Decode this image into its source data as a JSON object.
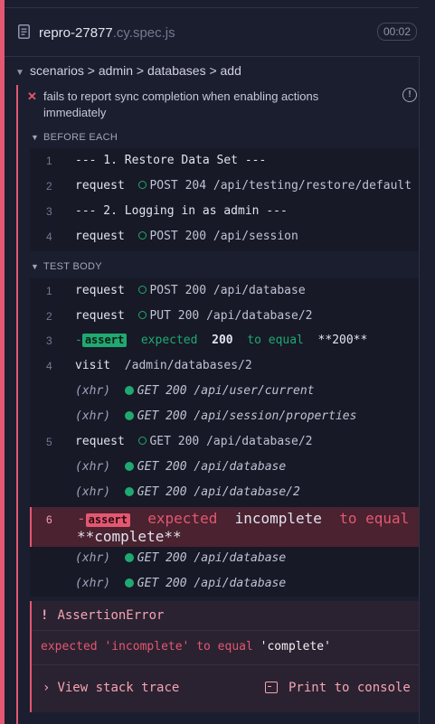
{
  "spec": {
    "name": "repro-27877",
    "ext": ".cy.spec.js",
    "duration": "00:02"
  },
  "suite": {
    "path": "scenarios > admin > databases > add"
  },
  "test": {
    "title": "fails to report sync completion when enabling actions immediately"
  },
  "before_each": {
    "label": "BEFORE EACH",
    "rows": [
      {
        "num": "1",
        "text": "--- 1. Restore Data Set ---"
      },
      {
        "num": "2",
        "cmd": "request",
        "method": "POST 204",
        "path": "/api/testing/restore/default"
      },
      {
        "num": "3",
        "text": "--- 2. Logging in as admin ---"
      },
      {
        "num": "4",
        "cmd": "request",
        "method": "POST 200",
        "path": "/api/session"
      }
    ]
  },
  "test_body": {
    "label": "TEST BODY",
    "rows": [
      {
        "num": "1",
        "cmd": "request",
        "method": "POST 200",
        "path": "/api/database"
      },
      {
        "num": "2",
        "cmd": "request",
        "method": "PUT 200",
        "path": "/api/database/2"
      },
      {
        "num": "3",
        "badge": "assert",
        "expected": "expected",
        "val1": "200",
        "to_equal": "to equal",
        "val2": "**200**"
      },
      {
        "num": "4",
        "cmd": "visit",
        "path": "/admin/databases/2"
      },
      {
        "xhr": "(xhr)",
        "method": "GET 200",
        "path": "/api/user/current"
      },
      {
        "xhr": "(xhr)",
        "method": "GET 200",
        "path": "/api/session/properties"
      },
      {
        "num": "5",
        "cmd": "request",
        "method": "GET 200",
        "path": "/api/database/2"
      },
      {
        "xhr": "(xhr)",
        "method": "GET 200",
        "path": "/api/database"
      },
      {
        "xhr": "(xhr)",
        "method": "GET 200",
        "path": "/api/database/2"
      },
      {
        "num": "6",
        "badge": "assert",
        "expected": "expected",
        "val1": "incomplete",
        "to_equal": "to equal",
        "val2": "**complete**"
      },
      {
        "xhr": "(xhr)",
        "method": "GET 200",
        "path": "/api/database"
      },
      {
        "xhr": "(xhr)",
        "method": "GET 200",
        "path": "/api/database"
      }
    ]
  },
  "error": {
    "bang": "!",
    "type": "AssertionError",
    "msg_prefix": "expected",
    "actual": "'incomplete'",
    "msg_mid": "to equal",
    "expected": "'complete'",
    "stack_label": "View stack trace",
    "console_label": "Print to console"
  },
  "colors": {
    "fail": "#e45770",
    "pass": "#1fa971",
    "background": "#1b1e2e"
  }
}
